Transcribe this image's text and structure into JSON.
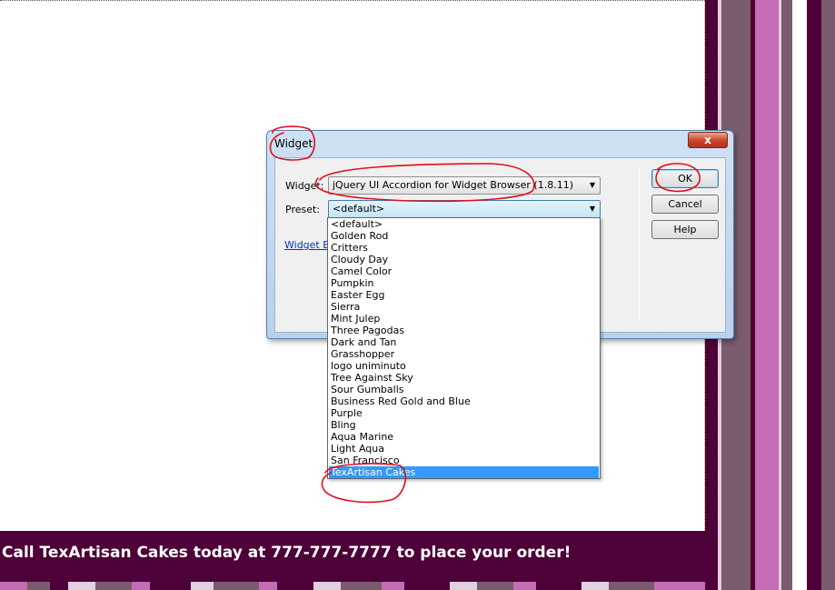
{
  "dialog": {
    "title": "Widget",
    "close_label": "x",
    "widget_label": "Widget:",
    "widget_value": "jQuery UI Accordion for Widget Browser (1.8.11)",
    "preset_label": "Preset:",
    "preset_value": "<default>",
    "link_text": "Widget Bro",
    "buttons": {
      "ok": "OK",
      "cancel": "Cancel",
      "help": "Help"
    }
  },
  "dropdown": {
    "options": [
      "<default>",
      "Golden Rod",
      "Critters",
      "Cloudy Day",
      "Camel Color",
      "Pumpkin",
      "Easter Egg",
      "Sierra",
      "Mint Julep",
      "Three Pagodas",
      "Dark and Tan",
      "Grasshopper",
      "logo uniminuto",
      "Tree Against Sky",
      "Sour Gumballs",
      "Business Red Gold and Blue",
      "Purple",
      "Bling",
      "Aqua Marine",
      "Light Aqua",
      "San Francisco",
      "TexArtisan Cakes"
    ],
    "selected_index": 21
  },
  "footer": {
    "text": "Call TexArtisan Cakes today at 777-777-7777 to place your order!"
  },
  "colors": {
    "footer_bg": "#4e0138",
    "stripe_dark": "#4e0138",
    "stripe_mauve": "#7a5c6e",
    "stripe_pink": "#c46db4",
    "stripe_light": "#e2cfe0",
    "annotation_red": "#e0101a",
    "selection_blue": "#3399ff"
  }
}
